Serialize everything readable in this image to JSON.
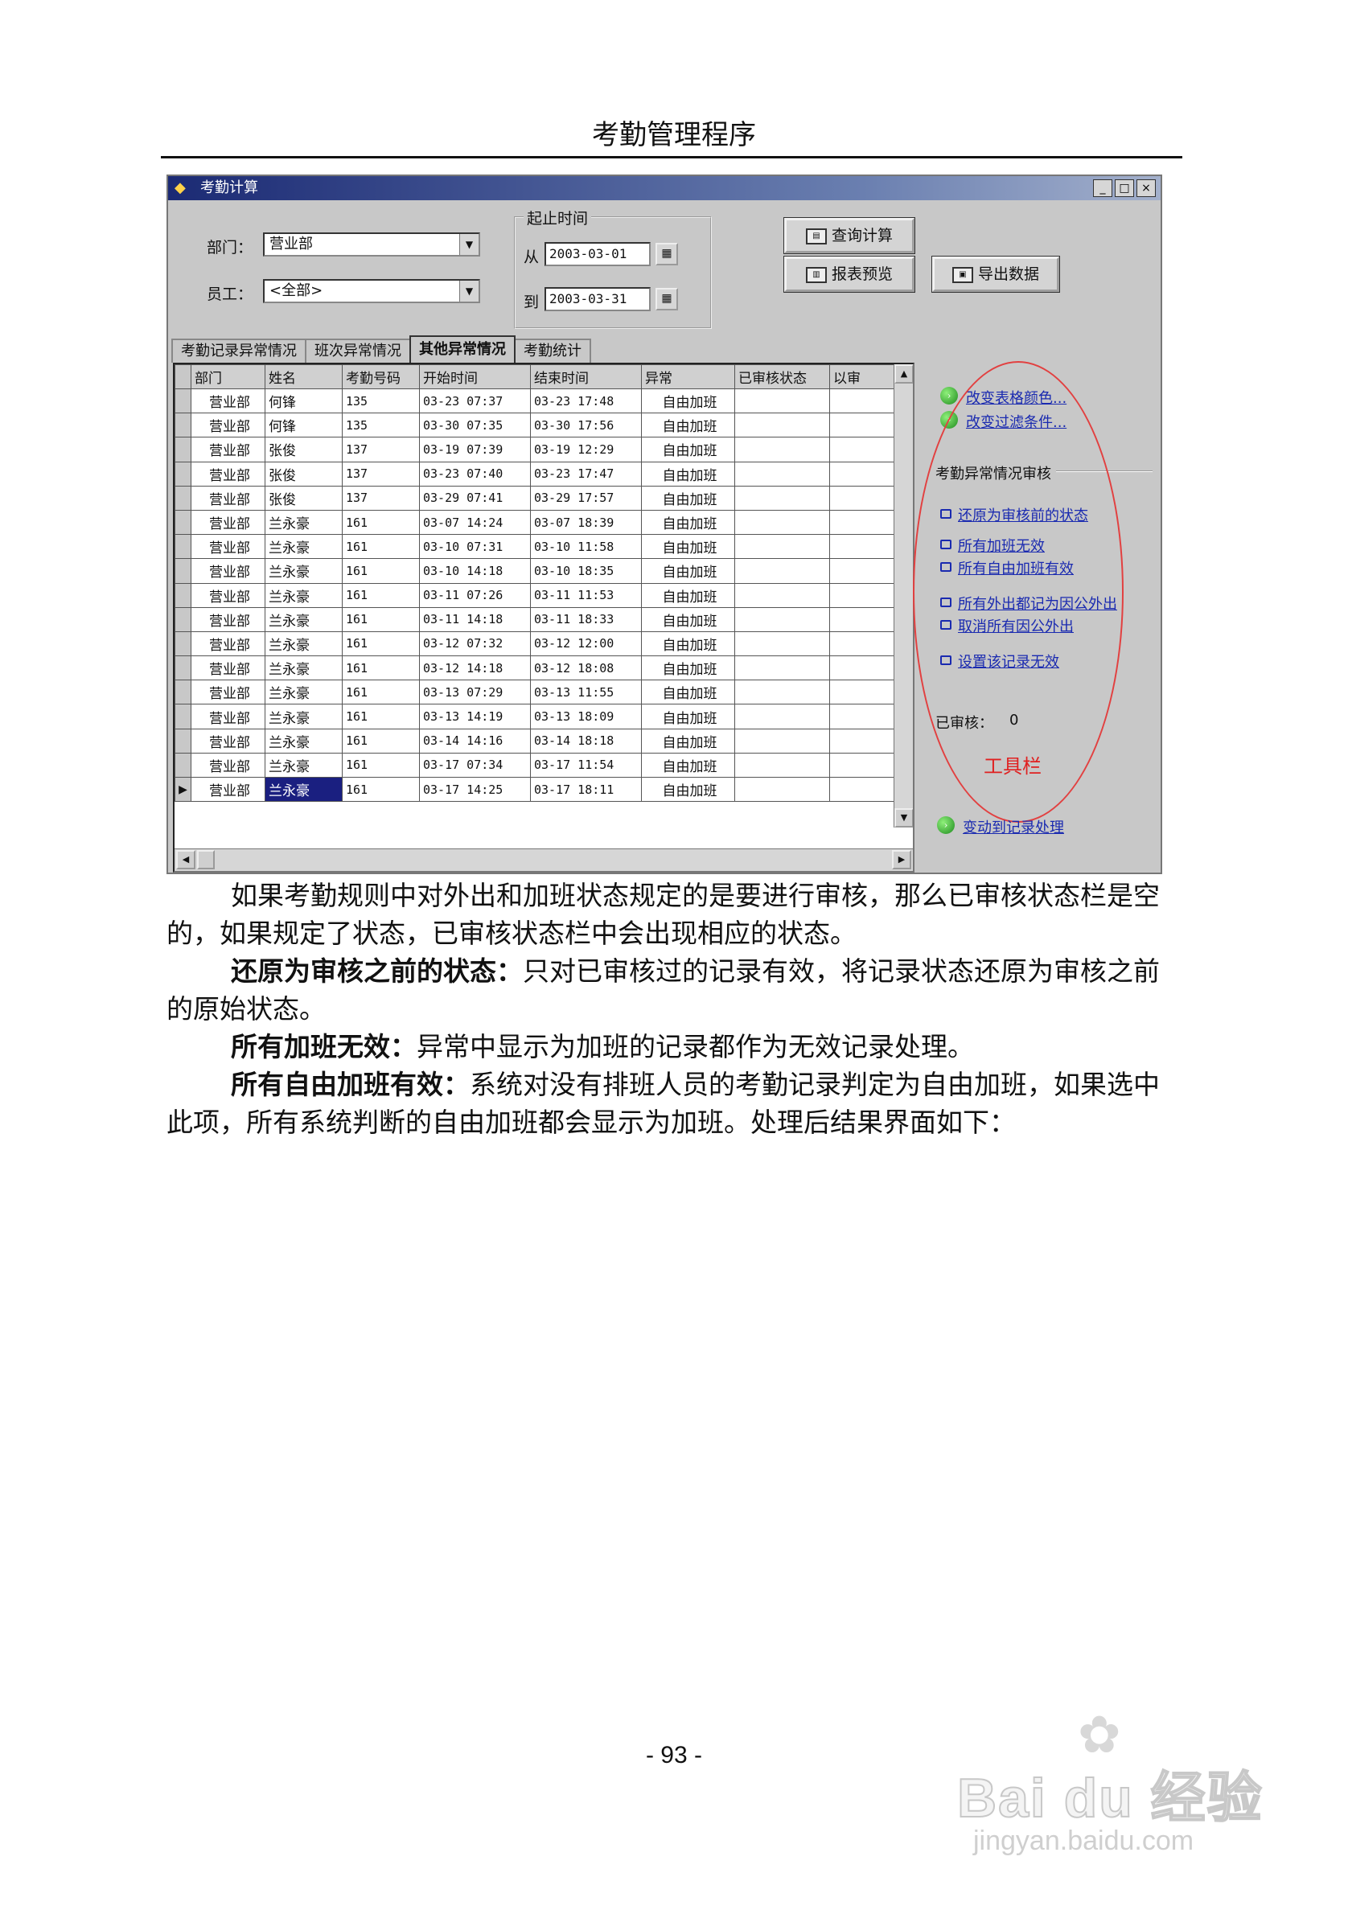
{
  "page": {
    "header_title": "考勤管理程序",
    "page_number": "- 93 -"
  },
  "window": {
    "title": "考勤计算",
    "controls": {
      "dept_label": "部门：",
      "dept_value": "营业部",
      "emp_label": "员工：",
      "emp_value": "<全部>",
      "period_label": "起止时间",
      "from_label": "从",
      "from_value": "2003-03-01",
      "to_label": "到",
      "to_value": "2003-03-31"
    },
    "buttons": {
      "query": "查询计算",
      "preview": "报表预览",
      "export": "导出数据"
    },
    "tabs": [
      "考勤记录异常情况",
      "班次异常情况",
      "其他异常情况",
      "考勤统计"
    ],
    "active_tab": 2,
    "grid": {
      "columns": [
        "部门",
        "姓名",
        "考勤号码",
        "开始时间",
        "结束时间",
        "异常",
        "已审核状态",
        "以审"
      ],
      "rows": [
        [
          "营业部",
          "何锋",
          "135",
          "03-23 07:37",
          "03-23 17:48",
          "自由加班",
          "",
          ""
        ],
        [
          "营业部",
          "何锋",
          "135",
          "03-30 07:35",
          "03-30 17:56",
          "自由加班",
          "",
          ""
        ],
        [
          "营业部",
          "张俊",
          "137",
          "03-19 07:39",
          "03-19 12:29",
          "自由加班",
          "",
          ""
        ],
        [
          "营业部",
          "张俊",
          "137",
          "03-23 07:40",
          "03-23 17:47",
          "自由加班",
          "",
          ""
        ],
        [
          "营业部",
          "张俊",
          "137",
          "03-29 07:41",
          "03-29 17:57",
          "自由加班",
          "",
          ""
        ],
        [
          "营业部",
          "兰永豪",
          "161",
          "03-07 14:24",
          "03-07 18:39",
          "自由加班",
          "",
          ""
        ],
        [
          "营业部",
          "兰永豪",
          "161",
          "03-10 07:31",
          "03-10 11:58",
          "自由加班",
          "",
          ""
        ],
        [
          "营业部",
          "兰永豪",
          "161",
          "03-10 14:18",
          "03-10 18:35",
          "自由加班",
          "",
          ""
        ],
        [
          "营业部",
          "兰永豪",
          "161",
          "03-11 07:26",
          "03-11 11:53",
          "自由加班",
          "",
          ""
        ],
        [
          "营业部",
          "兰永豪",
          "161",
          "03-11 14:18",
          "03-11 18:33",
          "自由加班",
          "",
          ""
        ],
        [
          "营业部",
          "兰永豪",
          "161",
          "03-12 07:32",
          "03-12 12:00",
          "自由加班",
          "",
          ""
        ],
        [
          "营业部",
          "兰永豪",
          "161",
          "03-12 14:18",
          "03-12 18:08",
          "自由加班",
          "",
          ""
        ],
        [
          "营业部",
          "兰永豪",
          "161",
          "03-13 07:29",
          "03-13 11:55",
          "自由加班",
          "",
          ""
        ],
        [
          "营业部",
          "兰永豪",
          "161",
          "03-13 14:19",
          "03-13 18:09",
          "自由加班",
          "",
          ""
        ],
        [
          "营业部",
          "兰永豪",
          "161",
          "03-14 14:16",
          "03-14 18:18",
          "自由加班",
          "",
          ""
        ],
        [
          "营业部",
          "兰永豪",
          "161",
          "03-17 07:34",
          "03-17 11:54",
          "自由加班",
          "",
          ""
        ],
        [
          "营业部",
          "兰永豪",
          "161",
          "03-17 14:25",
          "03-17 18:11",
          "自由加班",
          "",
          ""
        ]
      ],
      "selected_row": 16
    },
    "right_panel": {
      "top_links": [
        "改变表格颜色...",
        "改变过滤条件..."
      ],
      "section_title": "考勤异常情况审核",
      "review_links": [
        "还原为审核前的状态",
        "所有加班无效",
        "所有自由加班有效",
        "所有外出都记为因公外出",
        "取消所有因公外出",
        "设置该记录无效"
      ],
      "reviewed_label": "已审核：",
      "reviewed_count": "0",
      "toolbar_annotation": "工具栏",
      "bottom_link": "变动到记录处理"
    }
  },
  "body": {
    "p1": "如果考勤规则中对外出和加班状态规定的是要进行审核，那么已审核状态栏是空的，如果规定了状态，已审核状态栏中会出现相应的状态。",
    "p2_bold": "还原为审核之前的状态：",
    "p2_text": "只对已审核过的记录有效，将记录状态还原为审核之前的原始状态。",
    "p3_bold": "所有加班无效：",
    "p3_text": "异常中显示为加班的记录都作为无效记录处理。",
    "p4_bold": "所有自由加班有效：",
    "p4_text": "系统对没有排班人员的考勤记录判定为自由加班，如果选中此项，所有系统判断的自由加班都会显示为加班。处理后结果界面如下："
  },
  "watermark": {
    "main": "Bai du 经验",
    "sub": "jingyan.baidu.com"
  }
}
